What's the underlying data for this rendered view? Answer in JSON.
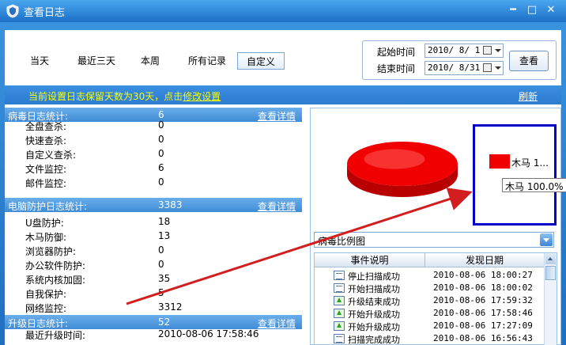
{
  "window": {
    "title": "查看日志"
  },
  "tabs": [
    {
      "label": "当天"
    },
    {
      "label": "最近三天"
    },
    {
      "label": "本周"
    },
    {
      "label": "所有记录"
    },
    {
      "label": "自定义"
    }
  ],
  "dates": {
    "start_label": "起始时间",
    "start_value": "2010/ 8/ 1",
    "end_label": "结束时间",
    "end_value": "2010/ 8/31",
    "view_button": "查看"
  },
  "notice": {
    "text": "当前设置日志保留天数为30天，点击",
    "link": "修改设置",
    "refresh": "刷新"
  },
  "sections": [
    {
      "title": "病毒日志统计:",
      "count": "6",
      "link": "查看详情",
      "rows": [
        {
          "label": "全盘查杀:",
          "value": "0"
        },
        {
          "label": "快速查杀:",
          "value": "0"
        },
        {
          "label": "自定义查杀:",
          "value": "0"
        },
        {
          "label": "文件监控:",
          "value": "6"
        },
        {
          "label": "邮件监控:",
          "value": "0"
        }
      ]
    },
    {
      "title": "电脑防护日志统计:",
      "count": "3383",
      "link": "查看详情",
      "rows": [
        {
          "label": "U盘防护:",
          "value": "18"
        },
        {
          "label": "木马防御:",
          "value": "13"
        },
        {
          "label": "浏览器防护:",
          "value": "0"
        },
        {
          "label": "办公软件防护:",
          "value": "0"
        },
        {
          "label": "系统内核加固:",
          "value": "35"
        },
        {
          "label": "自我保护:",
          "value": "5"
        },
        {
          "label": "网络监控:",
          "value": "3312"
        }
      ]
    },
    {
      "title": "升级日志统计:",
      "count": "52",
      "link": "查看详情",
      "rows": [
        {
          "label": "最近升级时间:",
          "value": "2010-08-06 17:58:46"
        }
      ]
    }
  ],
  "chart_data": {
    "type": "pie",
    "categories": [
      "木马"
    ],
    "values": [
      100.0
    ],
    "legend": [
      "木马 1..."
    ],
    "tooltip": "木马 100.0%",
    "color": "#f00000"
  },
  "chart_selector": {
    "value": "病毒比例图"
  },
  "events": {
    "headers": [
      "事件说明",
      "发现日期"
    ],
    "rows": [
      {
        "icon": "doc",
        "name": "停止扫描成功",
        "date": "2010-08-06 18:00:27"
      },
      {
        "icon": "doc",
        "name": "开始扫描成功",
        "date": "2010-08-06 18:00:02"
      },
      {
        "icon": "up",
        "name": "升级结束成功",
        "date": "2010-08-06 17:59:32"
      },
      {
        "icon": "up",
        "name": "开始升级成功",
        "date": "2010-08-06 17:58:46"
      },
      {
        "icon": "up",
        "name": "开始升级成功",
        "date": "2010-08-06 17:27:09"
      },
      {
        "icon": "doc",
        "name": "扫描完成成功",
        "date": "2010-08-06 16:56:43"
      }
    ]
  }
}
